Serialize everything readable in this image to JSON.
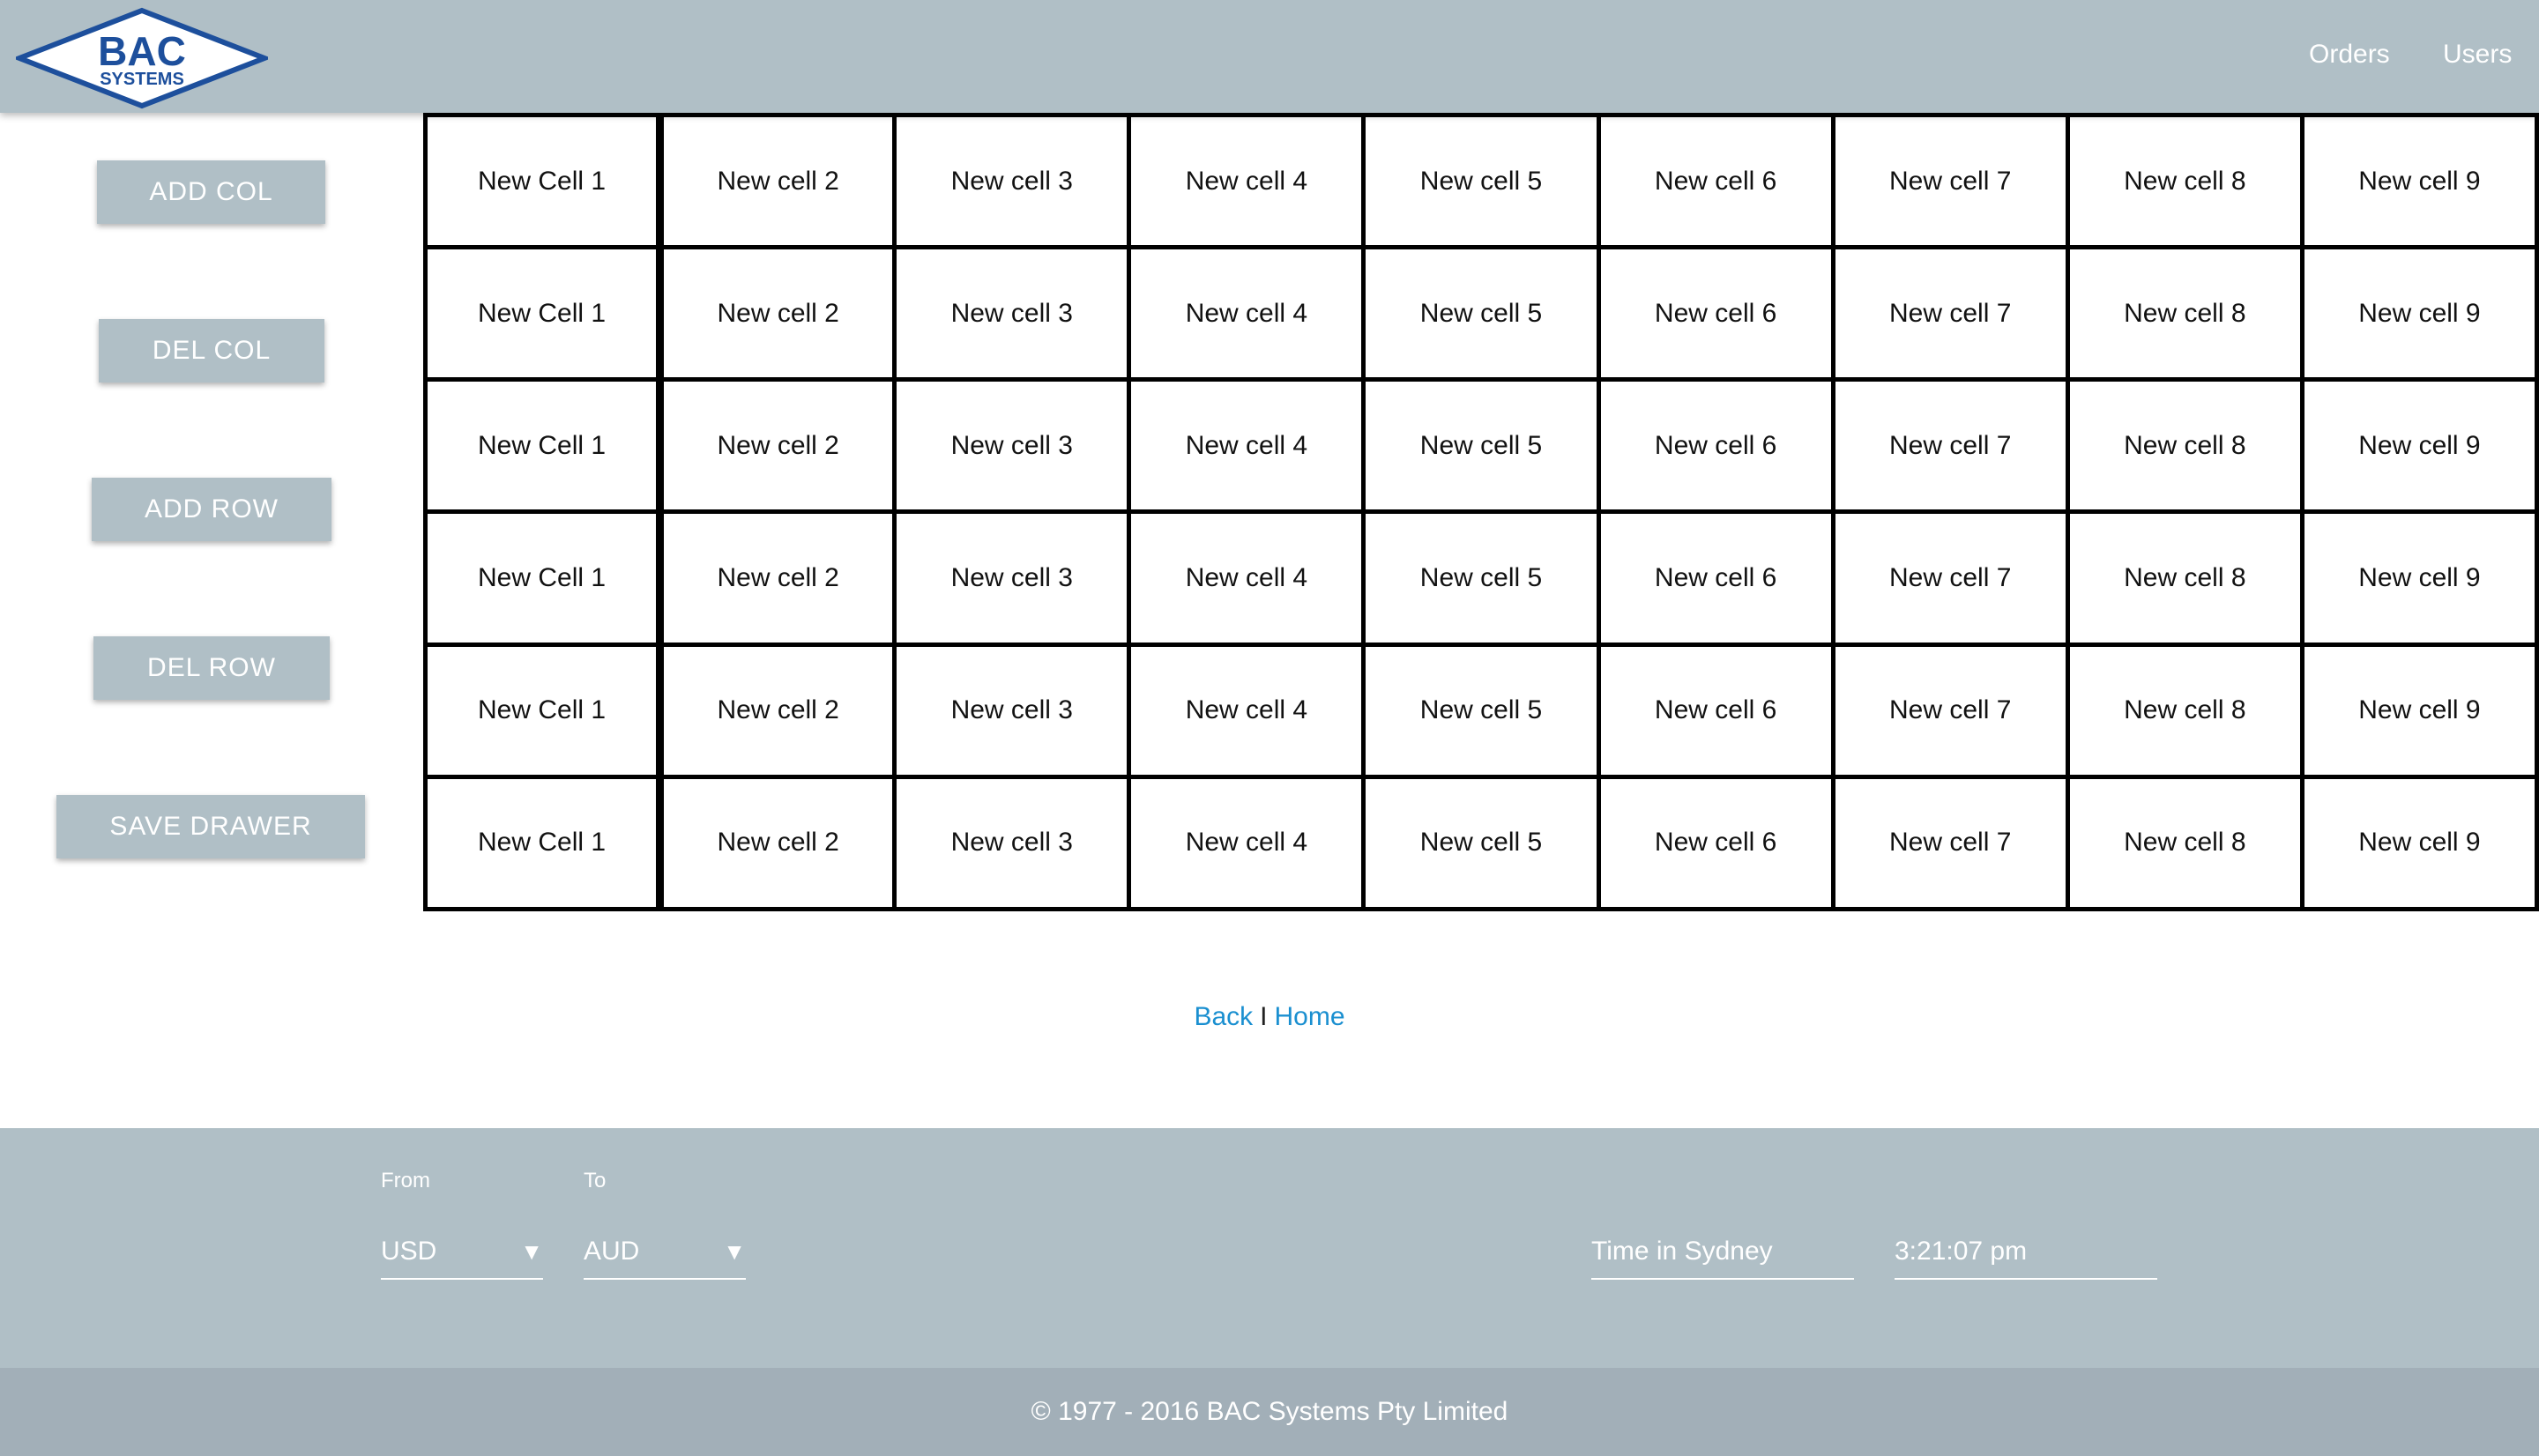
{
  "header": {
    "logo": {
      "main_text": "BAC",
      "sub_text": "SYSTEMS"
    },
    "nav": [
      {
        "label": "Orders"
      },
      {
        "label": "Users"
      }
    ]
  },
  "sidebar": {
    "add_col": "ADD COL",
    "del_col": "DEL COL",
    "add_row": "ADD ROW",
    "del_row": "DEL ROW",
    "save_drawer": "SAVE DRAWER"
  },
  "grid": {
    "rows": [
      [
        "New Cell 1",
        "New cell 2",
        "New cell 3",
        "New cell 4",
        "New cell 5",
        "New cell 6",
        "New cell 7",
        "New cell 8",
        "New cell 9"
      ],
      [
        "New Cell 1",
        "New cell 2",
        "New cell 3",
        "New cell 4",
        "New cell 5",
        "New cell 6",
        "New cell 7",
        "New cell 8",
        "New cell 9"
      ],
      [
        "New Cell 1",
        "New cell 2",
        "New cell 3",
        "New cell 4",
        "New cell 5",
        "New cell 6",
        "New cell 7",
        "New cell 8",
        "New cell 9"
      ],
      [
        "New Cell 1",
        "New cell 2",
        "New cell 3",
        "New cell 4",
        "New cell 5",
        "New cell 6",
        "New cell 7",
        "New cell 8",
        "New cell 9"
      ],
      [
        "New Cell 1",
        "New cell 2",
        "New cell 3",
        "New cell 4",
        "New cell 5",
        "New cell 6",
        "New cell 7",
        "New cell 8",
        "New cell 9"
      ],
      [
        "New Cell 1",
        "New cell 2",
        "New cell 3",
        "New cell 4",
        "New cell 5",
        "New cell 6",
        "New cell 7",
        "New cell 8",
        "New cell 9"
      ]
    ]
  },
  "links": {
    "back": "Back",
    "separator": "I",
    "home": "Home"
  },
  "footer": {
    "currency": {
      "from_label": "From",
      "from_value": "USD",
      "to_label": "To",
      "to_value": "AUD",
      "arrow": "▼"
    },
    "time": {
      "label": "Time in Sydney",
      "value": "3:21:07 pm"
    },
    "copyright": "© 1977 - 2016 BAC Systems Pty Limited"
  },
  "colors": {
    "header_bg": "#b0bfc6",
    "footer_bg": "#b0bfc6",
    "copyright_bg": "#a2afb8",
    "link": "#1a8fd0",
    "logo_blue": "#1d4f9c"
  }
}
